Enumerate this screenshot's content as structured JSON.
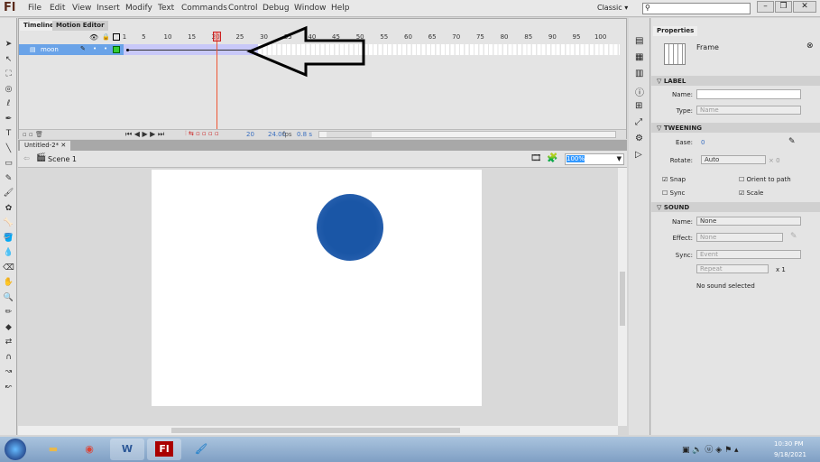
{
  "app": {
    "logo": "Fl",
    "workspace": "Classic ▾",
    "window_buttons": [
      "–",
      "❐",
      "✕"
    ]
  },
  "menu": [
    "File",
    "Edit",
    "View",
    "Insert",
    "Modify",
    "Text",
    "Commands",
    "Control",
    "Debug",
    "Window",
    "Help"
  ],
  "timeline": {
    "tabs": [
      "Timeline",
      "Motion Editor"
    ],
    "ruler": [
      "1",
      "5",
      "10",
      "15",
      "20",
      "25",
      "30",
      "35",
      "40",
      "45",
      "50",
      "55",
      "60",
      "65",
      "70",
      "75",
      "80",
      "85",
      "90",
      "95",
      "100"
    ],
    "layer": "moon",
    "current_frame": "20",
    "fps": "24.00",
    "fps_unit": "fps",
    "time": "0.8 s",
    "tween_end_frame": 28
  },
  "document": {
    "tab": "Untitled-2*",
    "scene": "Scene 1",
    "zoom": "100%"
  },
  "stage": {
    "circle_color": "#1a56a6"
  },
  "properties": {
    "tab": "Properties",
    "type": "Frame",
    "label": {
      "title": "LABEL",
      "name_label": "Name:",
      "name_value": "",
      "type_label": "Type:",
      "type_value": "Name"
    },
    "tweening": {
      "title": "TWEENING",
      "ease_label": "Ease:",
      "ease_value": "0",
      "rotate_label": "Rotate:",
      "rotate_value": "Auto",
      "rotate_times": "× 0",
      "snap": "Snap",
      "snap_checked": true,
      "orient": "Orient to path",
      "orient_checked": false,
      "sync": "Sync",
      "sync_checked": false,
      "scale": "Scale",
      "scale_checked": true
    },
    "sound": {
      "title": "SOUND",
      "name_label": "Name:",
      "name_value": "None",
      "effect_label": "Effect:",
      "effect_value": "None",
      "sync_label": "Sync:",
      "sync_value": "Event",
      "repeat_value": "Repeat",
      "repeat_times": "x 1",
      "status": "No sound selected"
    }
  },
  "taskbar": {
    "apps": [
      "start",
      "explorer",
      "chrome",
      "word",
      "flash",
      "paint"
    ],
    "time": "10:30 PM",
    "date": "9/18/2021"
  }
}
